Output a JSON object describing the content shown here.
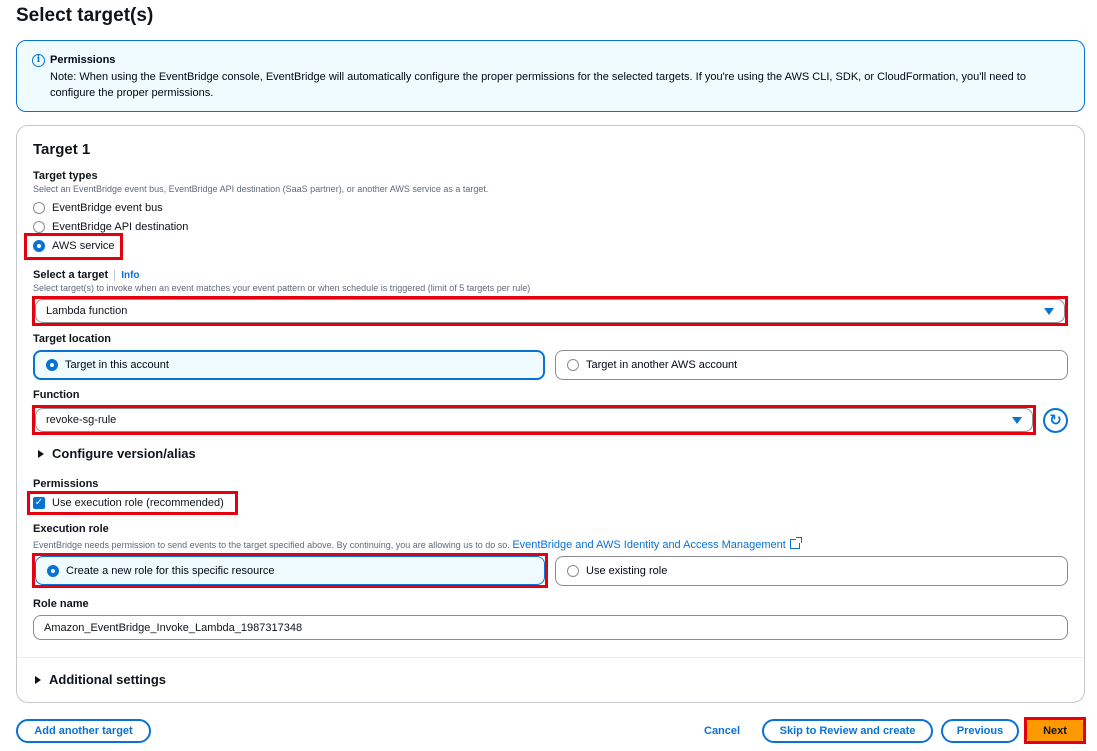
{
  "page": {
    "title": "Select target(s)"
  },
  "alert": {
    "title": "Permissions",
    "body": "Note: When using the EventBridge console, EventBridge will automatically configure the proper permissions for the selected targets. If you're using the AWS CLI, SDK, or CloudFormation, you'll need to configure the proper permissions."
  },
  "target": {
    "heading": "Target 1",
    "types": {
      "label": "Target types",
      "description": "Select an EventBridge event bus, EventBridge API destination (SaaS partner), or another AWS service as a target.",
      "options": [
        "EventBridge event bus",
        "EventBridge API destination",
        "AWS service"
      ],
      "selected": "AWS service"
    },
    "select_target": {
      "label": "Select a target",
      "info": "Info",
      "description": "Select target(s) to invoke when an event matches your event pattern or when schedule is triggered (limit of 5 targets per rule)",
      "value": "Lambda function"
    },
    "location": {
      "label": "Target location",
      "options": [
        "Target in this account",
        "Target in another AWS account"
      ],
      "selected": "Target in this account"
    },
    "function": {
      "label": "Function",
      "value": "revoke-sg-rule"
    },
    "configure_version": "Configure version/alias",
    "permissions": {
      "label": "Permissions",
      "checkbox": "Use execution role (recommended)",
      "checked": true
    },
    "execution_role": {
      "label": "Execution role",
      "description": "EventBridge needs permission to send events to the target specified above. By continuing, you are allowing us to do so.",
      "link": "EventBridge and AWS Identity and Access Management",
      "options": [
        "Create a new role for this specific resource",
        "Use existing role"
      ],
      "selected": "Create a new role for this specific resource"
    },
    "role_name": {
      "label": "Role name",
      "value": "Amazon_EventBridge_Invoke_Lambda_1987317348"
    },
    "additional_settings": "Additional settings"
  },
  "footer": {
    "add_target": "Add another target",
    "cancel": "Cancel",
    "skip": "Skip to Review and create",
    "previous": "Previous",
    "next": "Next"
  },
  "colors": {
    "accent": "#0972d3",
    "highlight": "#e3000f",
    "primary": "#ff9900"
  }
}
